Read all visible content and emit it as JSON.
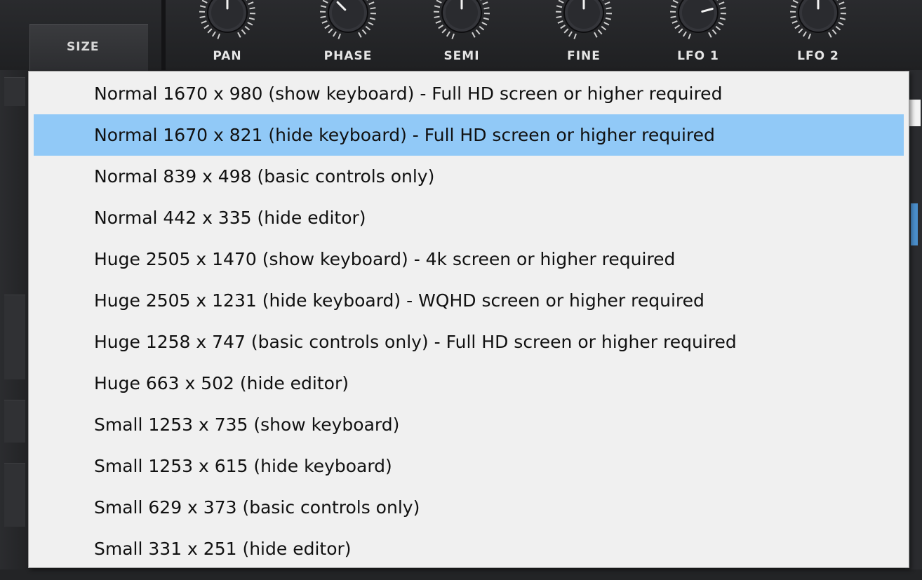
{
  "toolbar": {
    "size_label": "SIZE",
    "knobs": [
      {
        "label": "PAN"
      },
      {
        "label": "PHASE"
      },
      {
        "label": "SEMI"
      },
      {
        "label": "FINE"
      },
      {
        "label": "LFO 1"
      },
      {
        "label": "LFO 2"
      }
    ]
  },
  "size_menu": {
    "selected_index": 1,
    "highlight_color": "#91c9f7",
    "items": [
      {
        "label": "Normal 1670 x 980 (show keyboard) - Full HD screen or higher required"
      },
      {
        "label": "Normal 1670 x 821 (hide keyboard) - Full HD screen or higher required"
      },
      {
        "label": "Normal 839 x 498 (basic controls only)"
      },
      {
        "label": "Normal 442 x 335 (hide editor)"
      },
      {
        "label": "Huge 2505 x 1470 (show keyboard) - 4k screen or higher required"
      },
      {
        "label": "Huge 2505 x 1231 (hide keyboard) - WQHD screen or higher required"
      },
      {
        "label": "Huge 1258 x 747 (basic controls only) - Full HD screen or higher required"
      },
      {
        "label": "Huge 663 x 502 (hide editor)"
      },
      {
        "label": "Small 1253 x 735 (show keyboard)"
      },
      {
        "label": "Small 1253 x 615 (hide keyboard)"
      },
      {
        "label": "Small 629 x 373 (basic controls only)"
      },
      {
        "label": "Small 331 x 251 (hide editor)"
      }
    ]
  }
}
